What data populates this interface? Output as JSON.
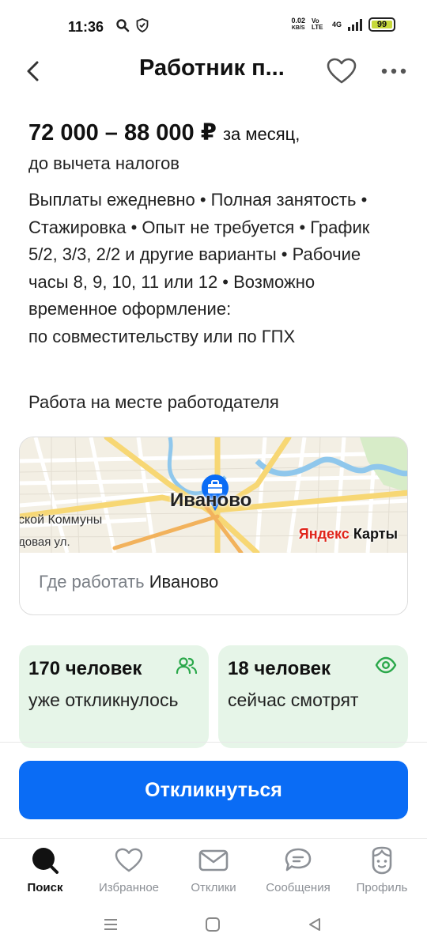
{
  "status_bar": {
    "time": "11:36",
    "speed_value": "0.02",
    "speed_unit": "KB/S",
    "network": "4G",
    "volte": "Vo LTE",
    "battery": "99"
  },
  "header": {
    "title": "Работник п...",
    "icons": [
      "back-arrow-icon",
      "heart-icon",
      "more-dots-icon"
    ]
  },
  "vacancy": {
    "salary": "72 000 – 88 000 ₽",
    "salary_period": "за месяц,",
    "salary_note": "до вычета налогов",
    "conditions": "Выплаты ежедневно • Полная занятость • Стажировка • Опыт не требуется • График 5/2, 3/3, 2/2 и другие варианты • Рабочие часы 8, 9, 10, 11 или 12 • Возможно временное оформление:",
    "conditions_tail": "по совместительству или по ГПХ",
    "workplace": "Работа на месте работодателя"
  },
  "map": {
    "city_label": "Иваново",
    "street_1": "ской Коммуны",
    "street_2": "довая ул.",
    "brand_ya": "Яндекс",
    "brand_maps": "Карты",
    "footer_label": "Где работать",
    "footer_value": "Иваново"
  },
  "stats": {
    "responded_count": "170 человек",
    "responded_text": "уже откликнулось",
    "viewing_count": "18 человек",
    "viewing_text": "сейчас смотрят"
  },
  "apply_label": "Откликнуться",
  "nav": {
    "items": [
      {
        "label": "Поиск",
        "icon": "search-icon",
        "active": true
      },
      {
        "label": "Избранное",
        "icon": "heart-icon",
        "active": false
      },
      {
        "label": "Отклики",
        "icon": "envelope-icon",
        "active": false
      },
      {
        "label": "Сообщения",
        "icon": "chat-icon",
        "active": false
      },
      {
        "label": "Профиль",
        "icon": "profile-icon",
        "active": false
      }
    ]
  },
  "colors": {
    "accent": "#0a6cf5",
    "stat_bg": "#e6f5e8",
    "stat_icon": "#2aa84a",
    "brand_red": "#e0251b"
  }
}
